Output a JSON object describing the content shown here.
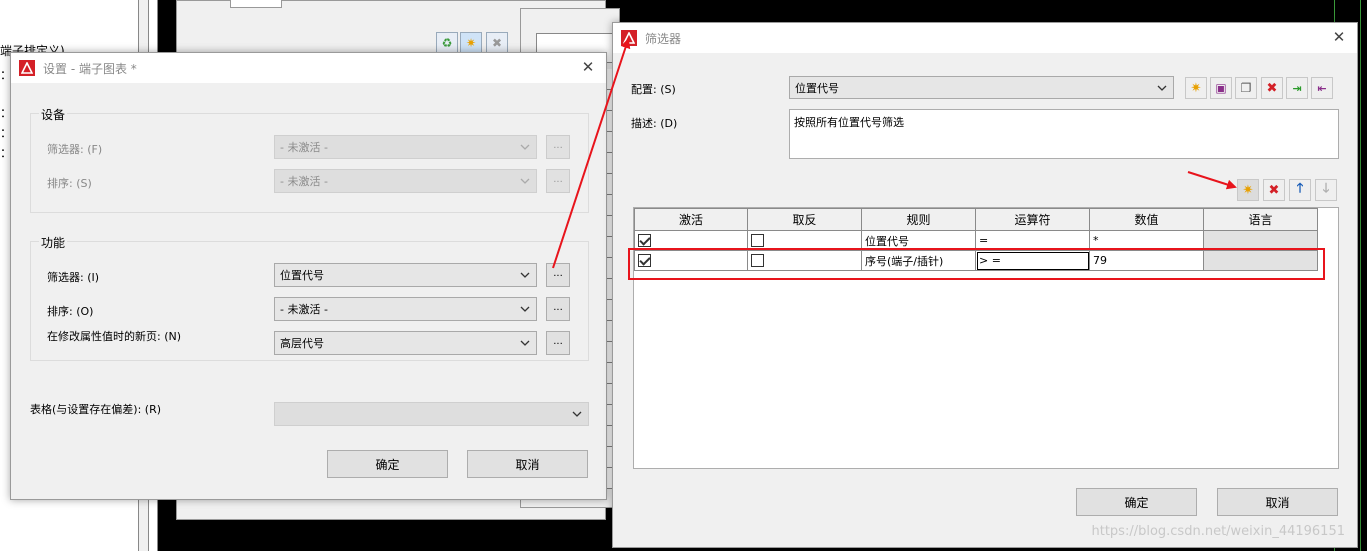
{
  "background": {
    "left_lines": [
      "端子排定义)",
      "：(",
      "：(",
      "：(",
      "：("
    ]
  },
  "settings_dialog": {
    "title": "设置 - 端子图表 *",
    "group_device": {
      "title": "设备",
      "filter_label": "筛选器: (F)",
      "filter_value": "- 未激活 -",
      "sort_label": "排序: (S)",
      "sort_value": "- 未激活 -"
    },
    "group_function": {
      "title": "功能",
      "filter_label": "筛选器: (I)",
      "filter_value": "位置代号",
      "sort_label": "排序: (O)",
      "sort_value": "- 未激活 -",
      "newpage_label": "在修改属性值时的新页: (N)",
      "newpage_value": "高层代号"
    },
    "table_label": "表格(与设置存在偏差): (R)",
    "table_value": "",
    "dots_label": "...",
    "ok_label": "确定",
    "cancel_label": "取消"
  },
  "filter_dialog": {
    "title": "筛选器",
    "config_label": "配置: (S)",
    "config_value": "位置代号",
    "desc_label": "描述: (D)",
    "desc_value": "按照所有位置代号筛选",
    "columns": [
      "激活",
      "取反",
      "规则",
      "运算符",
      "数值",
      "语言"
    ],
    "rows": [
      {
        "active": true,
        "negate": false,
        "rule": "位置代号",
        "operator": "=",
        "value": "*",
        "language": ""
      },
      {
        "active": true,
        "negate": false,
        "rule": "序号(端子/插针)",
        "operator": "> =",
        "value": "79",
        "language": ""
      }
    ],
    "ok_label": "确定",
    "cancel_label": "取消"
  },
  "watermark": "https://blog.csdn.net/weixin_44196151",
  "colors": {
    "annotation_red": "#e8141c",
    "brand_red": "#d42027"
  }
}
